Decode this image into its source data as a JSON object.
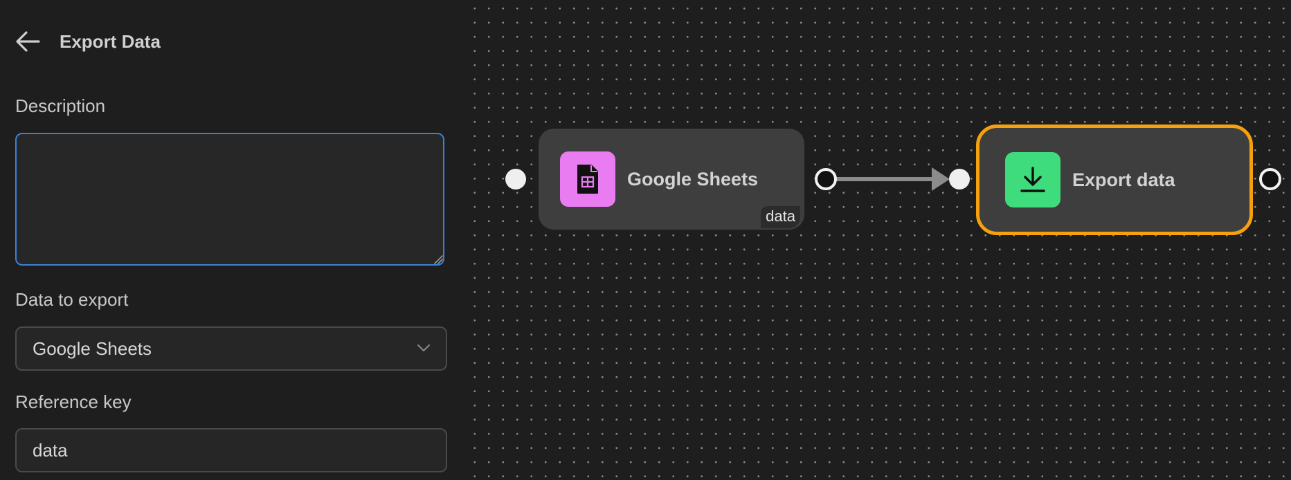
{
  "panel": {
    "title": "Export Data",
    "description": {
      "label": "Description",
      "value": ""
    },
    "data_to_export": {
      "label": "Data to export",
      "selected": "Google Sheets"
    },
    "reference_key": {
      "label": "Reference key",
      "value": "data"
    }
  },
  "canvas": {
    "nodes": [
      {
        "label": "Google Sheets",
        "icon": "google-sheets-icon",
        "icon_color": "#e97cf0",
        "output_badge": "data"
      },
      {
        "label": "Export data",
        "icon": "download-icon",
        "icon_color": "#3fdc7d",
        "selected": true,
        "selection_color": "#f5a00f"
      }
    ]
  },
  "colors": {
    "focus_border": "#3b82d6",
    "background": "#1e1e1e",
    "node_background": "#3e3e3e"
  }
}
